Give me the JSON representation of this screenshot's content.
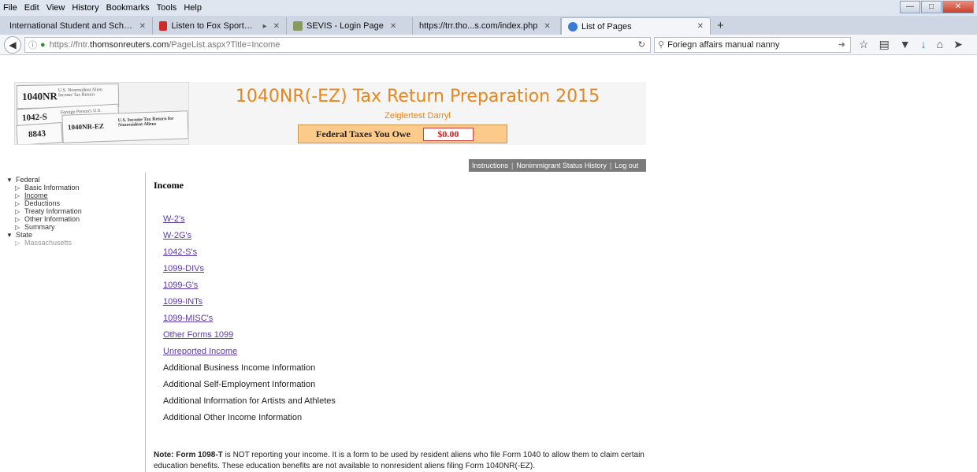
{
  "menu": [
    "File",
    "Edit",
    "View",
    "History",
    "Bookmarks",
    "Tools",
    "Help"
  ],
  "tabs": [
    {
      "label": "International Student and Scho...",
      "active": false,
      "favicon_color": "#4a6fb5"
    },
    {
      "label": "Listen to Fox Sports Ra...",
      "active": false,
      "favicon_color": "#d02929"
    },
    {
      "label": "SEVIS - Login Page",
      "active": false,
      "favicon_color": "#556b2f"
    },
    {
      "label": "https://trr.tho...s.com/index.php",
      "active": false,
      "favicon_color": ""
    },
    {
      "label": "List of Pages",
      "active": true,
      "favicon_color": "#3a7bd5"
    }
  ],
  "url": {
    "prefix": "https://fntr.",
    "domain": "thomsonreuters.com",
    "path": "/PageList.aspx?Title=Income"
  },
  "search_value": "Foriegn affairs manual nanny",
  "banner": {
    "title": "1040NR(-EZ) Tax Return Preparation 2015",
    "user": "Zeiglertest Darryl",
    "owe_label": "Federal Taxes You Owe",
    "owe_amount": "$0.00",
    "forms": {
      "f1040nr": "1040NR",
      "f1040nr_caption": "U.S. Nonresident Alien Income Tax Return",
      "f1042s": "1042-S",
      "f1042s_caption": "Foreign Person's U.S.",
      "f1040nrez": "1040NR-EZ",
      "f1040nrez_caption": "U.S. Income Tax Return for Nonresident Aliens",
      "f8843": "8843"
    }
  },
  "toplinks": [
    "Instructions",
    "Nonimmigrant Status History",
    "Log out"
  ],
  "leftnav": {
    "federal": "Federal",
    "federal_items": [
      "Basic Information",
      "Income",
      "Deductions",
      "Treaty Information",
      "Other Information",
      "Summary"
    ],
    "state": "State",
    "state_items": [
      "Massachusetts"
    ]
  },
  "main": {
    "title": "Income",
    "links": [
      "W-2's",
      "W-2G's",
      "1042-S's",
      "1099-DIVs",
      "1099-G's",
      "1099-INTs",
      "1099-MISC's",
      "Other Forms 1099",
      "Unreported Income"
    ],
    "plain": [
      "Additional Business Income Information",
      "Additional Self-Employment Information",
      "Additional Information for Artists and Athletes",
      "Additional Other Income Information"
    ],
    "note_bold": "Note: Form 1098-T",
    "note_text": " is NOT reporting your income. It is a form to be used by resident aliens who file Form 1040 to allow them to claim certain education benefits. These education benefits are not available to nonresident aliens filing Form 1040NR(-EZ)."
  }
}
